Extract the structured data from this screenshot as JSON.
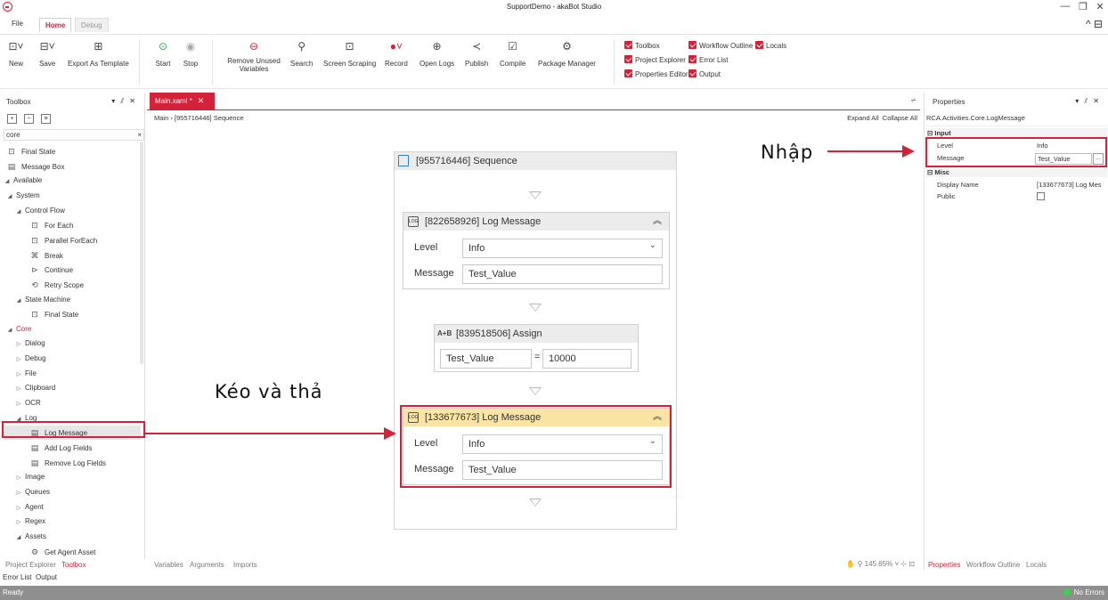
{
  "window": {
    "title": "SupportDemo - akaBot Studio",
    "minimize": "—",
    "restore": "❐",
    "close": "✕"
  },
  "ribbon_tabs": [
    "File",
    "Home",
    "Debug"
  ],
  "ribbon_right": "^ ⊟",
  "ribbon": {
    "buttons": [
      {
        "label": "New",
        "icon": "⊡˅"
      },
      {
        "label": "Save",
        "icon": "⊟˅"
      },
      {
        "label": "Export As Template",
        "icon": "⊞"
      },
      {
        "label": "Start",
        "icon": "⊙"
      },
      {
        "label": "Stop",
        "icon": "◉"
      },
      {
        "label": "Remove Unused Variables",
        "icon": "⊖"
      },
      {
        "label": "Search",
        "icon": "⚲"
      },
      {
        "label": "Screen Scraping",
        "icon": "⊡"
      },
      {
        "label": "Record",
        "icon": "●˅"
      },
      {
        "label": "Open Logs",
        "icon": "⊕"
      },
      {
        "label": "Publish",
        "icon": "≺"
      },
      {
        "label": "Compile",
        "icon": "☑"
      },
      {
        "label": "Package Manager",
        "icon": "⚙"
      }
    ],
    "panels": [
      "Toolbox",
      "Workflow Outline",
      "Locals",
      "Project Explorer",
      "Error List",
      "Properties Editor",
      "Output"
    ]
  },
  "toolbox": {
    "title": "Toolbox",
    "header_ctrls": "▾ ⫽ ✕",
    "search_value": "core",
    "search_clear": "×",
    "tree": [
      {
        "label": "Final State",
        "icon": "⊡",
        "indent": 1
      },
      {
        "label": "Message Box",
        "icon": "▤",
        "indent": 1
      },
      {
        "label": "Available",
        "icon": "◢",
        "indent": 0
      },
      {
        "label": "System",
        "icon": "◢",
        "indent": 1
      },
      {
        "label": "Control Flow",
        "icon": "◢",
        "indent": 2
      },
      {
        "label": "For Each",
        "icon": "⊡",
        "indent": 3
      },
      {
        "label": "Parallel ForEach",
        "icon": "⊡",
        "indent": 3
      },
      {
        "label": "Break",
        "icon": "⌘",
        "indent": 3
      },
      {
        "label": "Continue",
        "icon": "⊳",
        "indent": 3
      },
      {
        "label": "Retry Scope",
        "icon": "⟲",
        "indent": 3
      },
      {
        "label": "State Machine",
        "icon": "◢",
        "indent": 2
      },
      {
        "label": "Final State",
        "icon": "⊡",
        "indent": 3
      },
      {
        "label": "Core",
        "icon": "◢",
        "indent": 1
      },
      {
        "label": "Dialog",
        "icon": "▷",
        "indent": 2
      },
      {
        "label": "Debug",
        "icon": "▷",
        "indent": 2
      },
      {
        "label": "File",
        "icon": "▷",
        "indent": 2
      },
      {
        "label": "Clipboard",
        "icon": "▷",
        "indent": 2
      },
      {
        "label": "OCR",
        "icon": "▷",
        "indent": 2
      },
      {
        "label": "Log",
        "icon": "◢",
        "indent": 2
      },
      {
        "label": "Log Message",
        "icon": "▤",
        "indent": 3
      },
      {
        "label": "Add Log Fields",
        "icon": "▤",
        "indent": 3
      },
      {
        "label": "Remove Log Fields",
        "icon": "▤",
        "indent": 3
      },
      {
        "label": "Image",
        "icon": "▷",
        "indent": 2
      },
      {
        "label": "Queues",
        "icon": "▷",
        "indent": 2
      },
      {
        "label": "Agent",
        "icon": "▷",
        "indent": 2
      },
      {
        "label": "Regex",
        "icon": "▷",
        "indent": 2
      },
      {
        "label": "Assets",
        "icon": "◢",
        "indent": 2
      },
      {
        "label": "Get Agent Asset",
        "icon": "⚙",
        "indent": 3
      }
    ]
  },
  "left_bottom_tabs": [
    "Project Explorer",
    "Toolbox"
  ],
  "document": {
    "tab": "Main.xaml *",
    "tab_close": "✕",
    "filter_icon": "⩫",
    "breadcrumb": "Main  ›  [955716446] Sequence",
    "expand_all": "Expand All",
    "collapse_all": "Collapse All"
  },
  "workflow": {
    "sequence_title": "[955716446] Sequence",
    "log1": {
      "title": "[822658926] Log Message",
      "level_label": "Level",
      "level_value": "Info",
      "message_label": "Message",
      "message_value": "Test_Value"
    },
    "assign": {
      "title": "[839518506] Assign",
      "icon": "A+B",
      "to_value": "Test_Value",
      "eq": "=",
      "value": "10000"
    },
    "log2": {
      "title": "[133677673] Log Message",
      "level_label": "Level",
      "level_value": "Info",
      "message_label": "Message",
      "message_value": "Test_Value"
    },
    "collapse_icon": "︽"
  },
  "annotations": {
    "drag_drop": "Kéo và thả",
    "input": "Nhập"
  },
  "canvas_bottom_tabs": [
    "Variables",
    "Arguments",
    "Imports"
  ],
  "zoom": {
    "level": "145.65%",
    "controls": "✋ ⚲  145.65%  ˅  ⊹  ⊡"
  },
  "properties": {
    "title": "Properties",
    "header_ctrls": "▾ ⫽ ✕",
    "class_name": "RCA.Activities.Core.LogMessage",
    "input_category": "⊟ Input",
    "misc_category": "⊟ Misc",
    "rows": {
      "level": {
        "name": "Level",
        "value": "Info"
      },
      "message": {
        "name": "Message",
        "value": "Test_Value",
        "btn": "..."
      },
      "display_name": {
        "name": "Display Name",
        "value": "[133677673] Log Mes"
      },
      "public": {
        "name": "Public"
      }
    }
  },
  "right_bottom_tabs": [
    "Properties",
    "Workflow Outline",
    "Locals"
  ],
  "error_tabs": [
    "Error List",
    "Output"
  ],
  "status": {
    "left": "Ready",
    "right": "No Errors"
  },
  "colors": {
    "accent": "#d3223a",
    "highlight_header": "#fae4a4",
    "status_bar": "#8f8f8f"
  }
}
